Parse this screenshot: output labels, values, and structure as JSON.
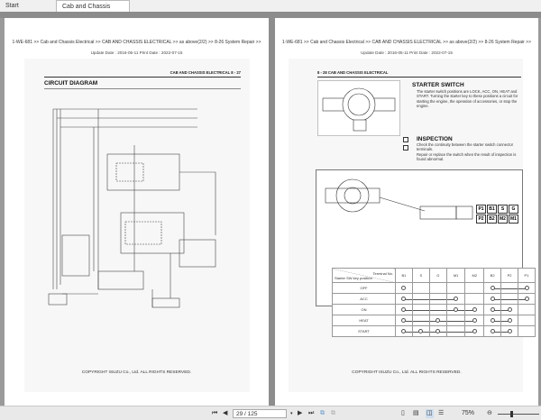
{
  "tabs": {
    "start": "Start",
    "active": "Cab and Chassis Electric...",
    "close": "×"
  },
  "left_page": {
    "breadcrumb": "1-WE-681 >> Cab and Chassis Electrical >> CAB AND CHASSIS ELECTRICAL >> as above(2/2) >> 8-26 System Repair >>",
    "dates": "Update Date : 2016-05-11   Print Date : 2022-07-15",
    "header": "CAB AND CHASSIS ELECTRICAL  8 - 27",
    "title": "CIRCUIT DIAGRAM",
    "copyright": "COPYRIGHT ISUZU Co., Ltd. ALL RIGHTS RESERVED."
  },
  "right_page": {
    "breadcrumb": "1-WE-681 >> Cab and Chassis Electrical >> CAB AND CHASSIS ELECTRICAL >> as above(2/2) >> 8-26 System Repair >>",
    "dates": "Update Date : 2016-05-11   Print Date : 2022-07-15",
    "header": "8 - 28  CAB AND CHASSIS ELECTRICAL",
    "starter_title": "STARTER SWITCH",
    "starter_text": "The starter switch positions are LOCK, ACC, ON, HEAT and START. Turning the starter key to these positions a circuit for starting the engine, the operation of accessories, or stop the engine.",
    "inspection_title": "INSPECTION",
    "inspection_text1": "Check the continuity between the starter switch connector terminals.",
    "inspection_text2": "Repair or replace the switch when the result of inspection is found abnormal.",
    "connector": {
      "top": [
        "P1",
        "B1",
        "S",
        "G"
      ],
      "bottom": [
        "P2",
        "B2",
        "M2",
        "M1"
      ]
    },
    "table": {
      "corner_top": "Terminal No.",
      "corner_bottom": "Starter SW key position",
      "columns": [
        "B1",
        "S",
        "G",
        "M1",
        "M2",
        "B2",
        "P2",
        "P1"
      ],
      "rows": [
        {
          "label": "OFF",
          "links": [
            [
              "B1"
            ],
            [
              "B2",
              "P1"
            ]
          ]
        },
        {
          "label": "ACC",
          "links": [
            [
              "B1",
              "M1"
            ],
            [
              "B2",
              "P1"
            ]
          ]
        },
        {
          "label": "ON",
          "links": [
            [
              "B1",
              "M1",
              "M2"
            ],
            [
              "B2",
              "P2"
            ]
          ]
        },
        {
          "label": "HEAT",
          "links": [
            [
              "B1",
              "G",
              "M2"
            ],
            [
              "B2",
              "P2"
            ]
          ]
        },
        {
          "label": "START",
          "links": [
            [
              "B1",
              "S",
              "G",
              "M2"
            ],
            [
              "B2",
              "P2"
            ]
          ]
        }
      ]
    },
    "copyright": "COPYRIGHT ISUZU Co., Ltd. ALL RIGHTS RESERVED."
  },
  "toolbar": {
    "page": "29 / 125",
    "zoom": "75%"
  }
}
